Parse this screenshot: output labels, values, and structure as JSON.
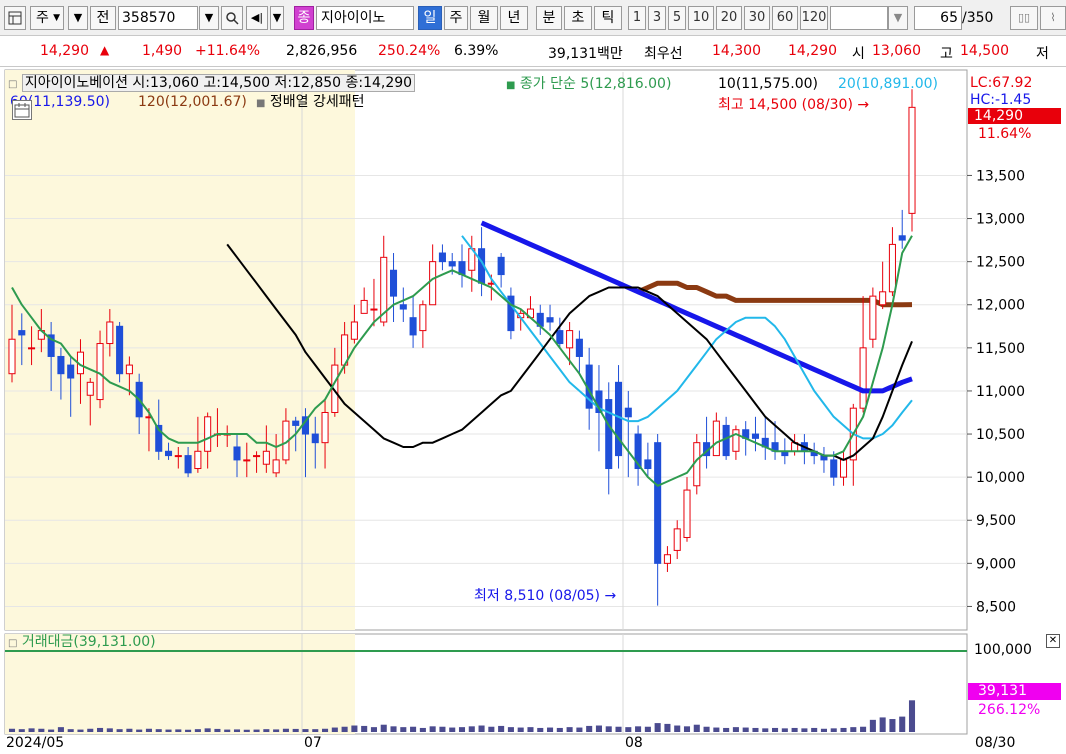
{
  "toolbar": {
    "layout_icon": "layout-grid-icon",
    "market_label": "주",
    "prev_label": "전",
    "code": "358570",
    "search_icon": "magnifier-icon",
    "sound_icon": "speaker-icon",
    "jong_label": "종",
    "stock_name": "지아이이노",
    "periods": [
      "일",
      "주",
      "월",
      "년",
      "분",
      "초",
      "틱"
    ],
    "active_period": "일",
    "intervals": [
      "1",
      "3",
      "5",
      "10",
      "20",
      "30",
      "60",
      "120"
    ],
    "count": "65",
    "count_total": "/350"
  },
  "quote": {
    "price": "14,290",
    "change": "1,490",
    "change_pct": "+11.64%",
    "volume": "2,826,956",
    "vol_ratio": "250.24%",
    "turnover": "6.39%",
    "amount": "39,131백만",
    "best_label": "최우선",
    "ask": "14,300",
    "bid": "14,290",
    "open_label": "시",
    "open": "13,060",
    "high_label": "고",
    "high": "14,500",
    "low_label": "저"
  },
  "legend": {
    "title": "지아이이노베이션 시:13,060 고:14,500 저:12,850 종:14,290",
    "ma_label": "종가 단순 5(12,816.00)",
    "ma10": "10(11,575.00)",
    "ma20": "20(10,891.00)",
    "ma60": "60(11,139.50)",
    "ma120": "120(12,001.67)",
    "pattern": "정배열 강세패턴",
    "lc": "LC:67.92",
    "hc": "HC:-1.45",
    "last_price": "14,290",
    "last_pct": "11.64%"
  },
  "annotations": {
    "high": "최고 14,500 (08/30)",
    "low": "최저 8,510 (08/05)"
  },
  "volume_panel": {
    "title": "거래대금(39,131.00)",
    "axis_top": "100,000",
    "last_value": "39,131",
    "last_pct": "266.12%"
  },
  "x_labels": [
    "2024/05",
    "07",
    "08",
    "08/30"
  ],
  "colors": {
    "up": "#e8000b",
    "down": "#1f4fd8",
    "ma5": "#2e9b4f",
    "ma10": "#000000",
    "ma20": "#22b8ea",
    "ma60": "#1717ea",
    "ma120": "#8b3a12",
    "volume": "#4b4b8f",
    "highlight": "#fdf8dc"
  },
  "chart_data": {
    "type": "candlestick",
    "y_ticks": [
      8500,
      9000,
      9500,
      10000,
      10500,
      11000,
      11500,
      12000,
      12500,
      13000,
      13500
    ],
    "ylim": [
      8250,
      14700
    ],
    "candles": [
      [
        11200,
        11600,
        11100,
        12000
      ],
      [
        11700,
        11650,
        11300,
        11900
      ],
      [
        11500,
        11500,
        11300,
        11750
      ],
      [
        11600,
        11700,
        11450,
        11950
      ],
      [
        11650,
        11400,
        11000,
        11800
      ],
      [
        11400,
        11200,
        10900,
        11500
      ],
      [
        11300,
        11150,
        10700,
        11400
      ],
      [
        11200,
        11450,
        10850,
        11600
      ],
      [
        10950,
        11100,
        10600,
        11150
      ],
      [
        10900,
        11550,
        10800,
        11700
      ],
      [
        11550,
        11800,
        11400,
        11950
      ],
      [
        11750,
        11200,
        11100,
        11800
      ],
      [
        11200,
        11300,
        10950,
        11400
      ],
      [
        11100,
        10700,
        10500,
        11200
      ],
      [
        10700,
        10700,
        10300,
        10800
      ],
      [
        10600,
        10300,
        10200,
        10900
      ],
      [
        10300,
        10250,
        10200,
        10400
      ],
      [
        10250,
        10250,
        10100,
        10350
      ],
      [
        10250,
        10050,
        10000,
        10350
      ],
      [
        10100,
        10300,
        10050,
        10700
      ],
      [
        10300,
        10700,
        10100,
        10750
      ],
      [
        10500,
        10500,
        10350,
        10800
      ],
      [
        10500,
        10500,
        10350,
        10600
      ],
      [
        10350,
        10200,
        10000,
        10500
      ],
      [
        10200,
        10200,
        10000,
        10400
      ],
      [
        10250,
        10250,
        10050,
        10300
      ],
      [
        10150,
        10300,
        10050,
        10600
      ],
      [
        10050,
        10200,
        10000,
        10500
      ],
      [
        10200,
        10650,
        10150,
        10800
      ],
      [
        10650,
        10600,
        10300,
        10700
      ],
      [
        10700,
        10500,
        10000,
        10800
      ],
      [
        10500,
        10400,
        10100,
        10700
      ],
      [
        10400,
        10750,
        10100,
        10900
      ],
      [
        10750,
        11300,
        10700,
        11500
      ],
      [
        11300,
        11650,
        11200,
        11800
      ],
      [
        11600,
        11800,
        11550,
        12000
      ],
      [
        11900,
        12050,
        11900,
        12200
      ],
      [
        11950,
        11950,
        11750,
        12300
      ],
      [
        11800,
        12550,
        11750,
        12800
      ],
      [
        12400,
        12100,
        11800,
        12600
      ],
      [
        12000,
        11950,
        11800,
        12200
      ],
      [
        11850,
        11650,
        11500,
        12100
      ],
      [
        11700,
        12000,
        11500,
        12050
      ],
      [
        12000,
        12500,
        12000,
        12700
      ],
      [
        12600,
        12500,
        12400,
        12700
      ],
      [
        12500,
        12450,
        12350,
        12600
      ],
      [
        12500,
        12350,
        12200,
        12700
      ],
      [
        12400,
        12650,
        12150,
        12800
      ],
      [
        12650,
        12250,
        12100,
        12900
      ],
      [
        12250,
        12250,
        12050,
        12350
      ],
      [
        12550,
        12350,
        12200,
        12600
      ],
      [
        12100,
        11700,
        11600,
        12200
      ],
      [
        11850,
        11900,
        11700,
        11950
      ],
      [
        11850,
        11950,
        11850,
        12100
      ],
      [
        11900,
        11750,
        11650,
        12000
      ],
      [
        11850,
        11800,
        11700,
        12000
      ],
      [
        11700,
        11550,
        11500,
        11850
      ],
      [
        11500,
        11700,
        11300,
        11800
      ],
      [
        11600,
        11400,
        11200,
        11700
      ],
      [
        11300,
        10800,
        10550,
        11500
      ],
      [
        11000,
        10750,
        10300,
        11300
      ],
      [
        10900,
        10100,
        9800,
        11100
      ],
      [
        11100,
        10250,
        10100,
        11300
      ],
      [
        10800,
        10700,
        10000,
        11000
      ],
      [
        10500,
        10100,
        9900,
        10600
      ],
      [
        10200,
        10100,
        10000,
        10400
      ],
      [
        10400,
        9000,
        8510,
        10500
      ],
      [
        9000,
        9100,
        8900,
        9200
      ],
      [
        9150,
        9400,
        9050,
        9500
      ],
      [
        9300,
        9850,
        9250,
        10000
      ],
      [
        9900,
        10400,
        9800,
        10500
      ],
      [
        10400,
        10250,
        10100,
        10700
      ],
      [
        10250,
        10650,
        10250,
        10750
      ],
      [
        10600,
        10250,
        10200,
        10700
      ],
      [
        10300,
        10550,
        10200,
        10600
      ],
      [
        10550,
        10450,
        10250,
        10650
      ],
      [
        10500,
        10450,
        10300,
        10700
      ],
      [
        10450,
        10350,
        10200,
        10700
      ],
      [
        10400,
        10300,
        10200,
        10650
      ],
      [
        10300,
        10250,
        10150,
        10450
      ],
      [
        10300,
        10400,
        10250,
        10500
      ],
      [
        10400,
        10300,
        10150,
        10500
      ],
      [
        10300,
        10250,
        10150,
        10400
      ],
      [
        10250,
        10200,
        10050,
        10350
      ],
      [
        10200,
        10000,
        9900,
        10300
      ],
      [
        10000,
        10200,
        9900,
        10300
      ],
      [
        10200,
        10800,
        9900,
        10850
      ],
      [
        10800,
        11500,
        10750,
        12100
      ],
      [
        11600,
        12100,
        11500,
        12200
      ],
      [
        12000,
        12150,
        11950,
        12500
      ],
      [
        12150,
        12700,
        12100,
        12900
      ],
      [
        12800,
        12750,
        12650,
        13100
      ],
      [
        13060,
        14290,
        12850,
        14500
      ]
    ],
    "ma5": [
      12200,
      12000,
      11850,
      11700,
      11600,
      11550,
      11400,
      11300,
      11250,
      11200,
      11100,
      11050,
      11000,
      10900,
      10750,
      10550,
      10450,
      10400,
      10400,
      10400,
      10450,
      10500,
      10500,
      10500,
      10500,
      10400,
      10400,
      10350,
      10400,
      10500,
      10650,
      10800,
      10900,
      11100,
      11300,
      11500,
      11650,
      11800,
      11900,
      12000,
      12050,
      12100,
      12200,
      12300,
      12350,
      12400,
      12350,
      12300,
      12250,
      12200,
      12100,
      12000,
      11950,
      11850,
      11750,
      11650,
      11500,
      11350,
      11200,
      11000,
      10800,
      10600,
      10450,
      10300,
      10150,
      10000,
      9900,
      9950,
      10000,
      10050,
      10200,
      10300,
      10400,
      10450,
      10500,
      10450,
      10400,
      10350,
      10300,
      10300,
      10300,
      10300,
      10300,
      10250,
      10250,
      10300,
      10500,
      10700,
      11100,
      11500,
      12000,
      12600,
      12800
    ],
    "ma10": [
      12700,
      12550,
      12400,
      12250,
      12100,
      11950,
      11800,
      11650,
      11450,
      11300,
      11150,
      11000,
      10850,
      10750,
      10650,
      10550,
      10450,
      10400,
      10350,
      10350,
      10400,
      10400,
      10450,
      10500,
      10550,
      10650,
      10750,
      10850,
      10950,
      11000,
      11150,
      11300,
      11450,
      11600,
      11750,
      11900,
      12000,
      12100,
      12150,
      12200,
      12200,
      12200,
      12200,
      12150,
      12100,
      12000,
      11900,
      11800,
      11700,
      11600,
      11450,
      11300,
      11150,
      11000,
      10850,
      10700,
      10600,
      10500,
      10400,
      10350,
      10300,
      10250,
      10250,
      10200,
      10250,
      10350,
      10450,
      10700,
      11000,
      11300,
      11575
    ],
    "ma20": [
      12800,
      12650,
      12500,
      12300,
      12150,
      12000,
      11850,
      11700,
      11550,
      11400,
      11250,
      11100,
      11000,
      10900,
      10800,
      10750,
      10700,
      10650,
      10650,
      10700,
      10800,
      10900,
      11000,
      11150,
      11300,
      11450,
      11600,
      11700,
      11800,
      11850,
      11850,
      11850,
      11750,
      11600,
      11400,
      11200,
      11000,
      10850,
      10700,
      10600,
      10500,
      10450,
      10450,
      10500,
      10600,
      10750,
      10891
    ],
    "ma60": [
      12950,
      12900,
      12850,
      12800,
      12750,
      12700,
      12650,
      12600,
      12550,
      12500,
      12450,
      12400,
      12350,
      12300,
      12250,
      12200,
      12150,
      12100,
      12050,
      12000,
      11950,
      11900,
      11850,
      11800,
      11750,
      11700,
      11650,
      11600,
      11550,
      11500,
      11450,
      11400,
      11350,
      11300,
      11250,
      11200,
      11150,
      11100,
      11050,
      11000,
      11000,
      11000,
      11050,
      11100,
      11139.5
    ],
    "ma120": [
      12150,
      12200,
      12250,
      12250,
      12250,
      12200,
      12200,
      12150,
      12100,
      12100,
      12050,
      12050,
      12050,
      12050,
      12050,
      12050,
      12050,
      12050,
      12050,
      12050,
      12050,
      12050,
      12050,
      12050,
      12050,
      12000,
      12000,
      12000,
      12001.67
    ],
    "volume_max": 100000,
    "volumes": [
      4000,
      3500,
      4500,
      4000,
      3000,
      6000,
      3500,
      3000,
      4000,
      5000,
      4500,
      3500,
      4000,
      3000,
      4000,
      3500,
      3000,
      3200,
      2800,
      3500,
      4500,
      3800,
      3000,
      3200,
      2800,
      3000,
      3500,
      3200,
      4000,
      3800,
      3600,
      3500,
      4000,
      5500,
      6500,
      8000,
      7500,
      6000,
      9000,
      7000,
      6000,
      6500,
      5000,
      7000,
      6500,
      5500,
      6000,
      7000,
      8000,
      6500,
      7500,
      6000,
      5500,
      6000,
      5000,
      5500,
      5000,
      6000,
      5500,
      7500,
      8000,
      7000,
      6500,
      6000,
      7000,
      6500,
      11000,
      10000,
      8000,
      7000,
      9000,
      6500,
      5500,
      5000,
      6000,
      5500,
      5000,
      4500,
      5000,
      4500,
      5000,
      4500,
      5000,
      4000,
      4500,
      5000,
      6000,
      6500,
      15000,
      18000,
      16000,
      19000,
      39131
    ]
  }
}
